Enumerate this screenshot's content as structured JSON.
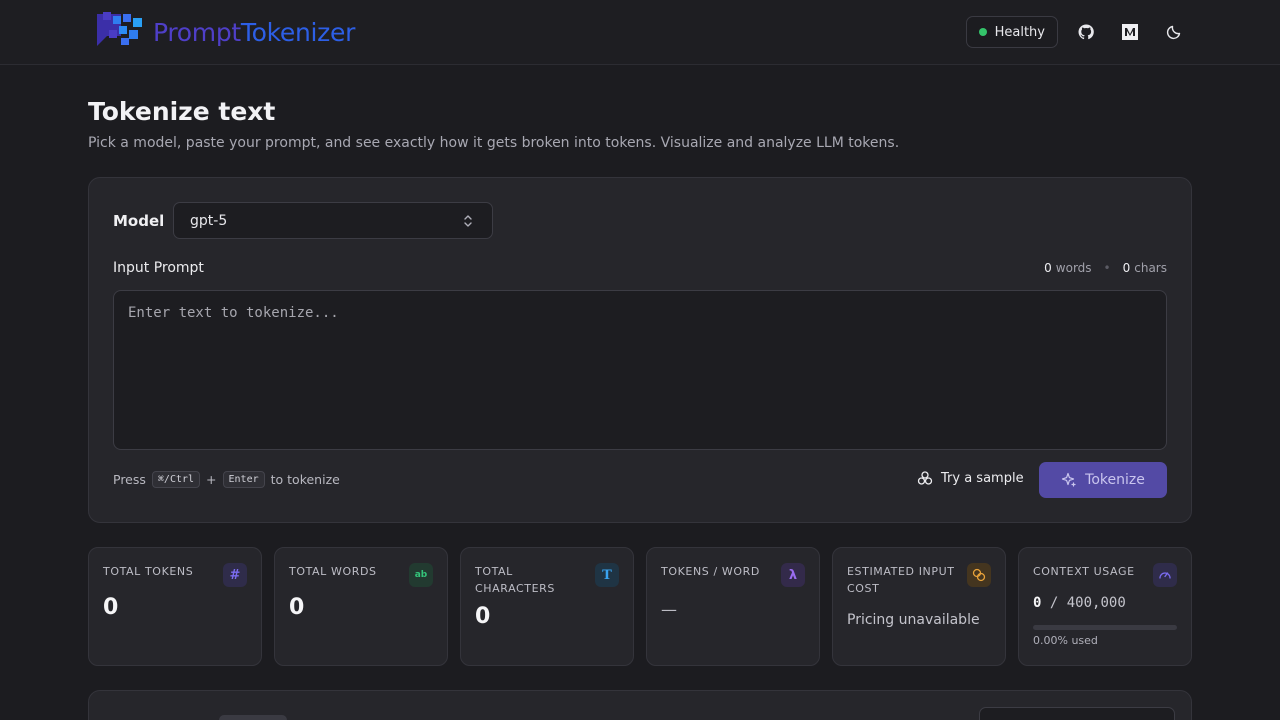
{
  "header": {
    "logo_part1": "Prompt",
    "logo_part2": "Tokenizer",
    "health_label": "Healthy",
    "links": [
      {
        "icon": "github-icon"
      },
      {
        "icon": "medium-icon"
      },
      {
        "icon": "moon-icon"
      }
    ]
  },
  "page": {
    "title": "Tokenize text",
    "subtitle": "Pick a model, paste your prompt, and see exactly how it gets broken into tokens. Visualize and analyze LLM tokens."
  },
  "form": {
    "model_label": "Model",
    "model_value": "gpt-5",
    "input_label": "Input Prompt",
    "word_count": "0",
    "word_unit": "words",
    "char_count": "0",
    "char_unit": "chars",
    "placeholder": "Enter text to tokenize...",
    "hint_press": "Press",
    "hint_key1": "⌘/Ctrl",
    "hint_plus": "+",
    "hint_key2": "Enter",
    "hint_suffix": "to tokenize",
    "sample_label": "Try a sample",
    "tokenize_label": "Tokenize"
  },
  "stats": [
    {
      "label": "TOTAL TOKENS",
      "value": "0",
      "icon": "hash-icon",
      "color": "#7b6cf0"
    },
    {
      "label": "TOTAL WORDS",
      "value": "0",
      "icon": "abc-icon",
      "color": "#34c47a"
    },
    {
      "label": "TOTAL CHARACTERS",
      "value": "0",
      "icon": "text-icon",
      "color": "#3aa3f0"
    },
    {
      "label": "TOKENS / WORD",
      "value": "—",
      "icon": "lambda-icon",
      "color": "#9a6cf0"
    },
    {
      "label": "ESTIMATED INPUT COST",
      "value": "Pricing unavailable",
      "icon": "coins-icon",
      "color": "#e8a23a"
    },
    {
      "label": "CONTEXT USAGE",
      "used": "0",
      "sep": "/",
      "limit": "400,000",
      "percent_label": "0.00% used",
      "fraction": 0.0,
      "icon": "gauge-icon",
      "color": "#7b6cf0"
    }
  ]
}
